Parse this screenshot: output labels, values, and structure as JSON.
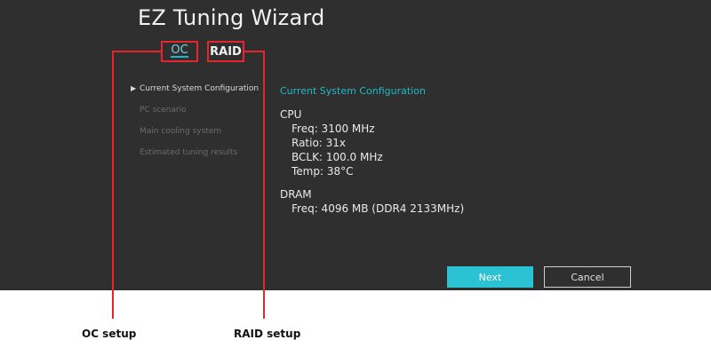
{
  "app": {
    "title": "EZ Tuning Wizard"
  },
  "tabs": [
    {
      "label": "OC"
    },
    {
      "label": "RAID"
    }
  ],
  "menu": {
    "items": [
      {
        "label": "Current System Configuration",
        "state": "selected"
      },
      {
        "label": "PC scenario",
        "state": "disabled"
      },
      {
        "label": "Main cooling system",
        "state": "disabled"
      },
      {
        "label": "Estimated tuning results",
        "state": "disabled"
      }
    ]
  },
  "panel": {
    "title": "Current System Configuration",
    "cpu": {
      "heading": "CPU",
      "freq": "Freq: 3100 MHz",
      "ratio": "Ratio: 31x",
      "bclk": "BCLK: 100.0 MHz",
      "temp": "Temp: 38°C"
    },
    "dram": {
      "heading": "DRAM",
      "freq": "Freq: 4096 MB (DDR4 2133MHz)"
    }
  },
  "buttons": {
    "next": "Next",
    "cancel": "Cancel"
  },
  "annotations": {
    "oc": "OC setup",
    "raid": "RAID setup"
  },
  "colors": {
    "accent": "#2bc2d3",
    "callout": "#e8252b",
    "background": "#2f2f2f"
  }
}
